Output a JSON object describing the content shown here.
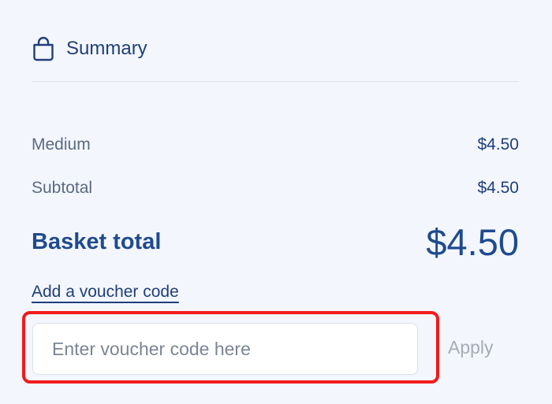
{
  "summary": {
    "title": "Summary",
    "icon": "shopping-bag-icon"
  },
  "lines": {
    "item_label": "Medium",
    "item_price": "$4.50",
    "subtotal_label": "Subtotal",
    "subtotal_value": "$4.50"
  },
  "total": {
    "label": "Basket total",
    "value": "$4.50"
  },
  "voucher": {
    "link_label": "Add a voucher code",
    "placeholder": "Enter voucher code here",
    "value": "",
    "apply_label": "Apply"
  },
  "colors": {
    "background": "#f3f6fd",
    "primary": "#1f4b8e",
    "highlight": "#f21b1b",
    "disabled": "#a6acb6"
  }
}
